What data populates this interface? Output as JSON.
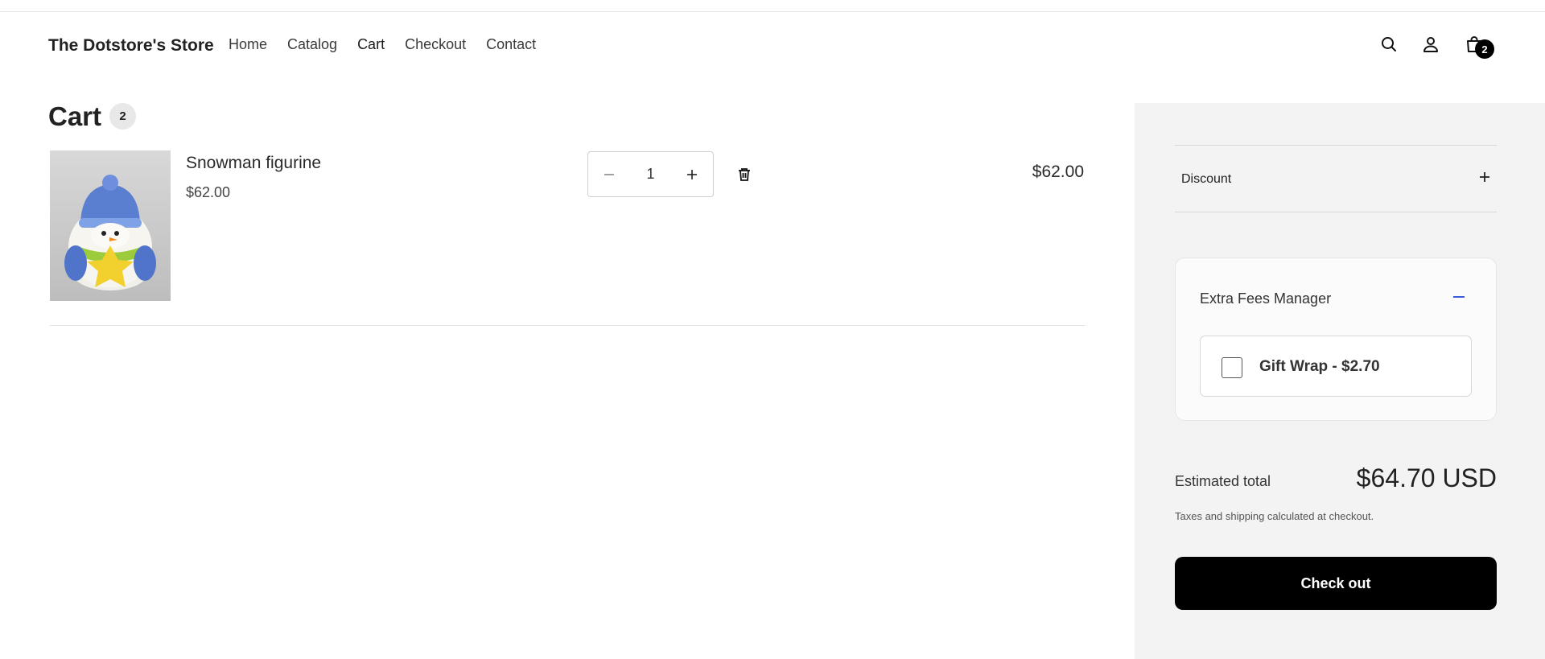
{
  "header": {
    "brand": "The Dotstore's Store",
    "nav": [
      "Home",
      "Catalog",
      "Cart",
      "Checkout",
      "Contact"
    ],
    "cart_count": "2",
    "icons": [
      "search-icon",
      "account-icon",
      "cart-icon"
    ]
  },
  "cart": {
    "title": "Cart",
    "count": "2",
    "item": {
      "name": "Snowman figurine",
      "price": "$62.00",
      "quantity": "1",
      "line_total": "$62.00"
    }
  },
  "summary": {
    "discount_label": "Discount",
    "fees_title": "Extra Fees Manager",
    "fee_option_label": "Gift Wrap - $2.70",
    "fee_checked": false,
    "estimated_label": "Estimated total",
    "estimated_value": "$64.70 USD",
    "tax_note": "Taxes and shipping calculated at checkout.",
    "checkout_label": "Check out"
  },
  "colors": {
    "accent": "#3b5bdb",
    "sidebar_bg": "#f3f3f3",
    "button_bg": "#000000",
    "badge_bg": "#000000"
  }
}
